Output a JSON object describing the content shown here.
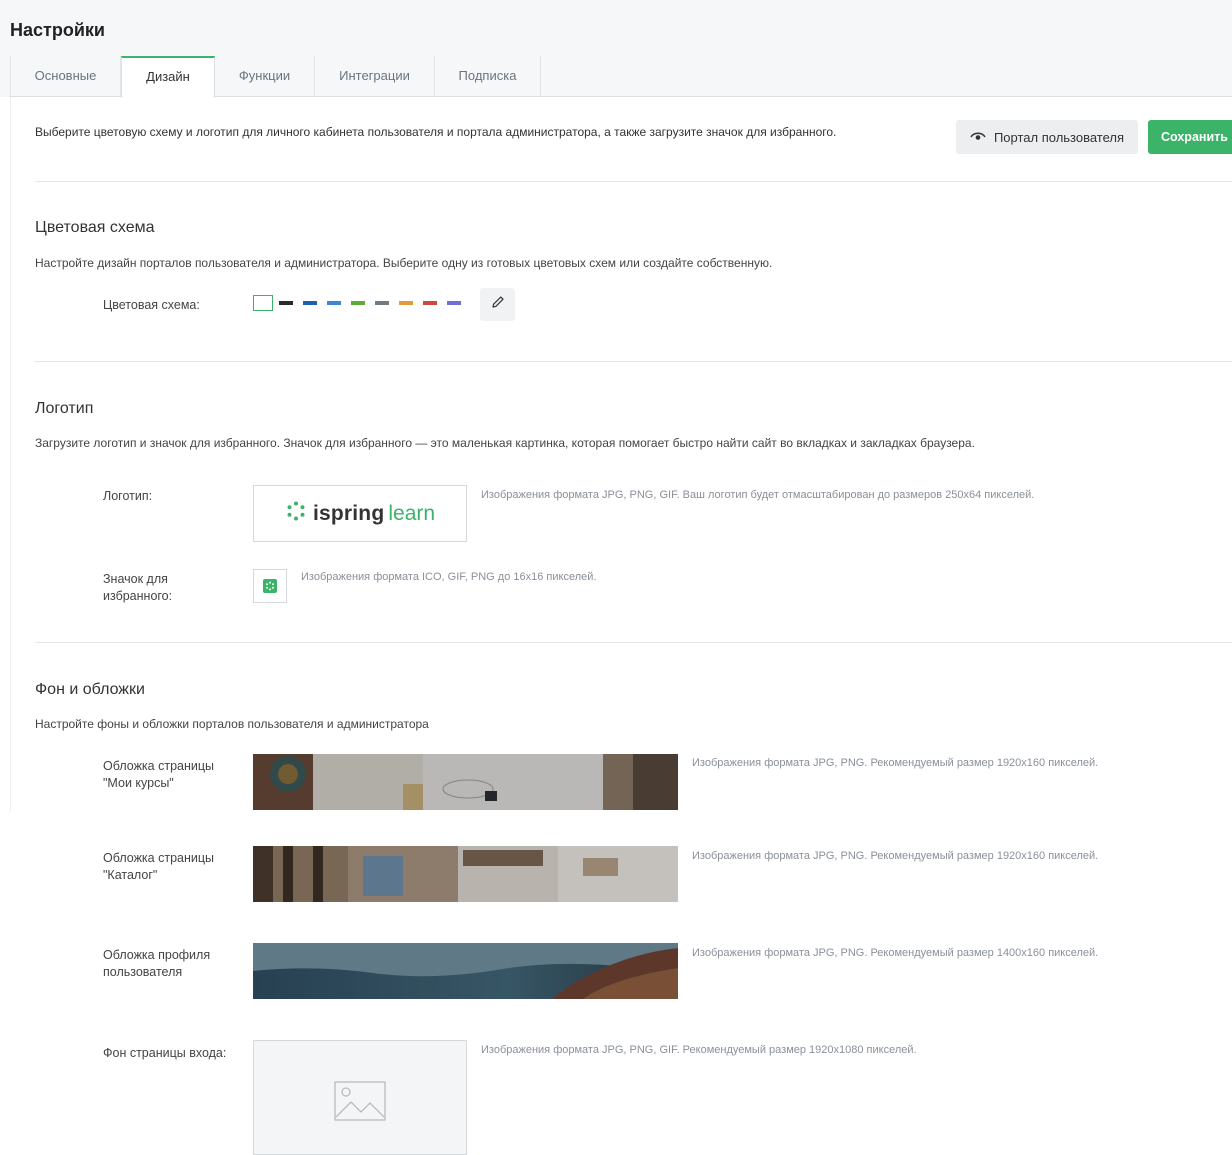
{
  "header": {
    "title": "Настройки"
  },
  "tabs": [
    {
      "label": "Основные"
    },
    {
      "label": "Дизайн",
      "active": true
    },
    {
      "label": "Функции"
    },
    {
      "label": "Интеграции"
    },
    {
      "label": "Подписка"
    }
  ],
  "intro": {
    "text": "Выберите цветовую схему и логотип для личного кабинета пользователя и портала администратора, а также загрузите значок для избранного.",
    "portal_button": "Портал пользователя",
    "save_button": "Сохранить"
  },
  "color_scheme": {
    "title": "Цветовая схема",
    "description": "Настройте дизайн порталов пользователя и администратора. Выберите одну из готовых цветовых схем или создайте собственную.",
    "label": "Цветовая схема:",
    "swatches": [
      "#ffffff",
      "#2b2b2b",
      "#1f5fb0",
      "#3d86d6",
      "#5aab3a",
      "#6f7b86",
      "#e59a3a",
      "#d0473b",
      "#6f6fd6"
    ]
  },
  "logo": {
    "title": "Логотип",
    "description": "Загрузите логотип и значок для избранного. Значок для избранного — это маленькая картинка, которая помогает быстро найти сайт во вкладках и закладках браузера.",
    "logo_label": "Логотип:",
    "logo_word1": "ispring",
    "logo_word2": "learn",
    "logo_hint": "Изображения формата JPG, PNG, GIF. Ваш логотип будет отмасштабирован до размеров 250x64 пикселей.",
    "favicon_label": "Значок для избранного:",
    "favicon_hint": "Изображения формата ICO, GIF, PNG до 16x16 пикселей."
  },
  "backgrounds": {
    "title": "Фон и обложки",
    "description": "Настройте фоны и обложки порталов пользователя и администратора",
    "items": [
      {
        "label": "Обложка страницы \"Мои курсы\"",
        "hint": "Изображения формата JPG, PNG. Рекомендуемый размер 1920x160 пикселей."
      },
      {
        "label": "Обложка страницы \"Каталог\"",
        "hint": "Изображения формата JPG, PNG. Рекомендуемый размер 1920x160 пикселей."
      },
      {
        "label": "Обложка профиля пользователя",
        "hint": "Изображения формата JPG, PNG. Рекомендуемый размер 1400x160 пикселей."
      },
      {
        "label": "Фон страницы входа:",
        "hint": "Изображения формата JPG, PNG, GIF. Рекомендуемый размер 1920x1080 пикселей."
      }
    ]
  },
  "colors": {
    "accent": "#3bb369"
  }
}
